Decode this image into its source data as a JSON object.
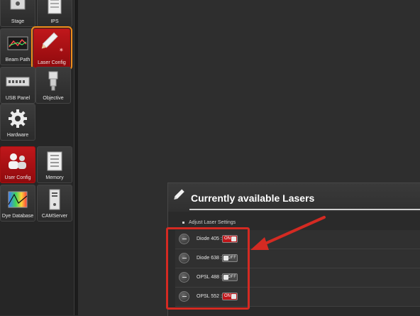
{
  "sidebar": {
    "tiles": [
      {
        "label": "Stage"
      },
      {
        "label": "IPS"
      },
      {
        "label": "Beam Path"
      },
      {
        "label": "Laser Config"
      },
      {
        "label": "USB Panel"
      },
      {
        "label": "Objective"
      },
      {
        "label": "Hardware"
      },
      {
        "label": "User Config"
      },
      {
        "label": "Memory"
      },
      {
        "label": "Dye Database"
      },
      {
        "label": "CAMServer"
      }
    ],
    "active_tile": "Laser Config"
  },
  "panel": {
    "title": "Currently available Lasers",
    "section": "Adjust Laser Settings",
    "lasers": [
      {
        "name": "Diode 405 :",
        "state": "ON"
      },
      {
        "name": "Diode 638 :",
        "state": "OFF"
      },
      {
        "name": "OPSL 488 :",
        "state": "OFF"
      },
      {
        "name": "OPSL 552 :",
        "state": "ON"
      }
    ]
  },
  "colors": {
    "accent": "#c0171b",
    "highlight": "#f28c1a",
    "annotation": "#d42a22"
  }
}
